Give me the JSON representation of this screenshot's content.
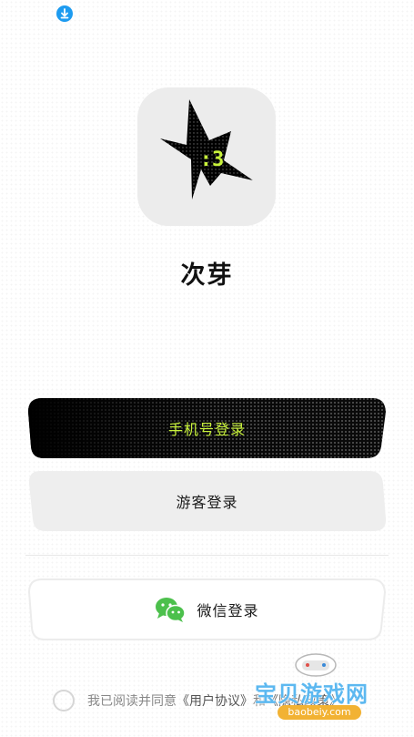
{
  "app": {
    "name": "次芽",
    "logo_text": ":3",
    "logo_accent": "#c8f23a"
  },
  "status_bar": {
    "indicator_icon": "download-icon",
    "indicator_color": "#1d9bf0"
  },
  "buttons": {
    "phone_login": "手机号登录",
    "guest_login": "游客登录",
    "wechat_login": "微信登录",
    "wechat_icon": "wechat-icon",
    "wechat_color": "#4cc04c"
  },
  "agreement": {
    "prefix": "我已阅读并同意",
    "user_agreement": "《用户协议》",
    "conjunction": "和",
    "privacy_policy": "《隐私政策》"
  },
  "watermark": {
    "title": "宝贝游戏网",
    "url": "baobeiy.com"
  }
}
